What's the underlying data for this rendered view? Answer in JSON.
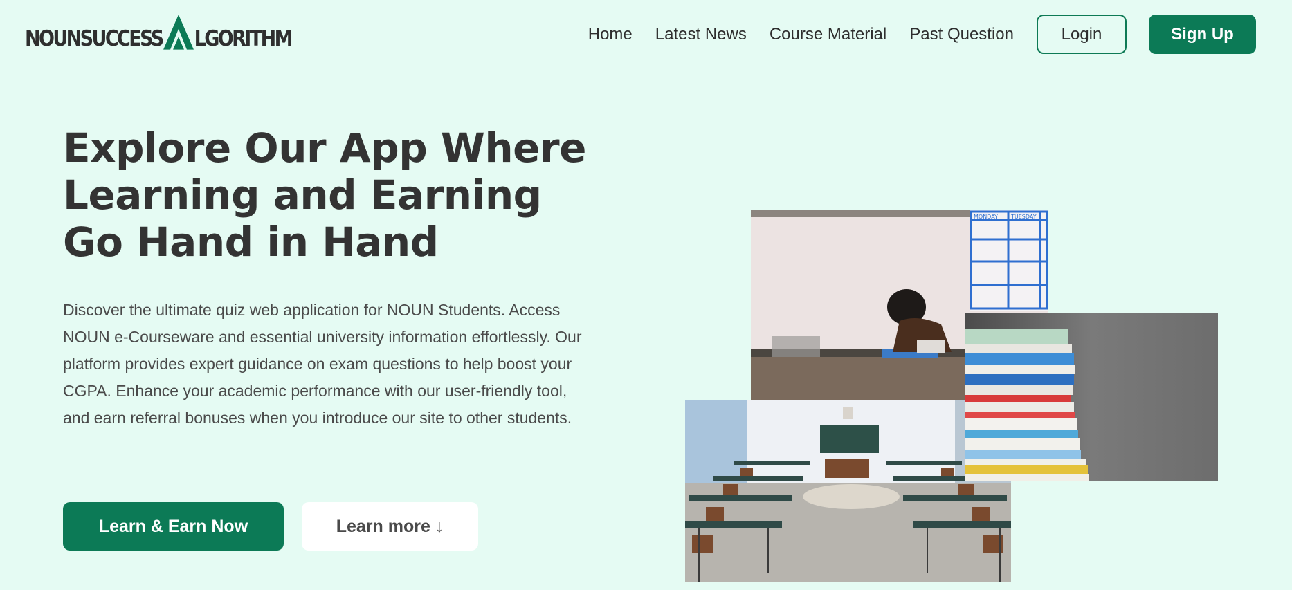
{
  "brand": {
    "name_left": "NOUNSUCCESS",
    "name_right": "LGORITHM",
    "accent_color": "#0c7a56"
  },
  "nav": {
    "links": [
      "Home",
      "Latest News",
      "Course Material",
      "Past Question"
    ],
    "login_label": "Login",
    "signup_label": "Sign Up"
  },
  "hero": {
    "title_lines": [
      "Explore Our App Where",
      "Learning and Earning",
      "Go Hand in Hand"
    ],
    "description": "Discover the ultimate quiz web application for NOUN Students. Access NOUN e-Courseware and essential university information effortlessly. Our platform provides expert guidance on exam questions to help boost your CGPA. Enhance your academic performance with our user-friendly tool, and earn referral bonuses when you introduce our site to other students.",
    "primary_cta": "Learn & Earn Now",
    "secondary_cta": "Learn more ↓"
  },
  "images": {
    "student": {
      "board_headers": [
        "MONDAY",
        "TUESDAY"
      ]
    }
  },
  "colors": {
    "background": "#e5fbf3",
    "primary": "#0c7a56",
    "text": "#333333"
  }
}
